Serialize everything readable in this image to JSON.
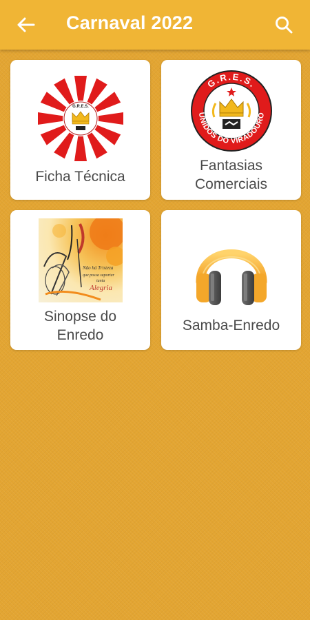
{
  "app": {
    "title": "Carnaval 2022",
    "colors": {
      "appbar": "#f0b535",
      "background": "#e3a532",
      "card": "#ffffff",
      "label": "#4a4a4a"
    }
  },
  "toolbar": {
    "back_icon": "arrow-left-icon",
    "search_icon": "search-icon"
  },
  "cards": [
    {
      "label": "Ficha Técnica",
      "icon": "red-starburst-logo"
    },
    {
      "label": "Fantasias\nComerciais",
      "label_line1": "Fantasias",
      "label_line2": "Comerciais",
      "icon": "gres-unidos-do-viradouro-emblem",
      "emblem_top": "G.R.E.S.",
      "emblem_bottom": "UNIDOS DO VIRADOURO"
    },
    {
      "label_line1": "Sinopse do",
      "label_line2": "Enredo",
      "icon": "enredo-artwork"
    },
    {
      "label": "Samba-Enredo",
      "icon": "headphones-icon"
    }
  ],
  "logo_text": {
    "ficha_ring": "UNIDOS DO VIRADOURO",
    "ficha_top": "G.R.E.S."
  },
  "sinopse_art_text": {
    "line1": "Não há Tristeza",
    "line2": "que possa suportar",
    "line3": "tanta",
    "line4": "Alegria"
  }
}
